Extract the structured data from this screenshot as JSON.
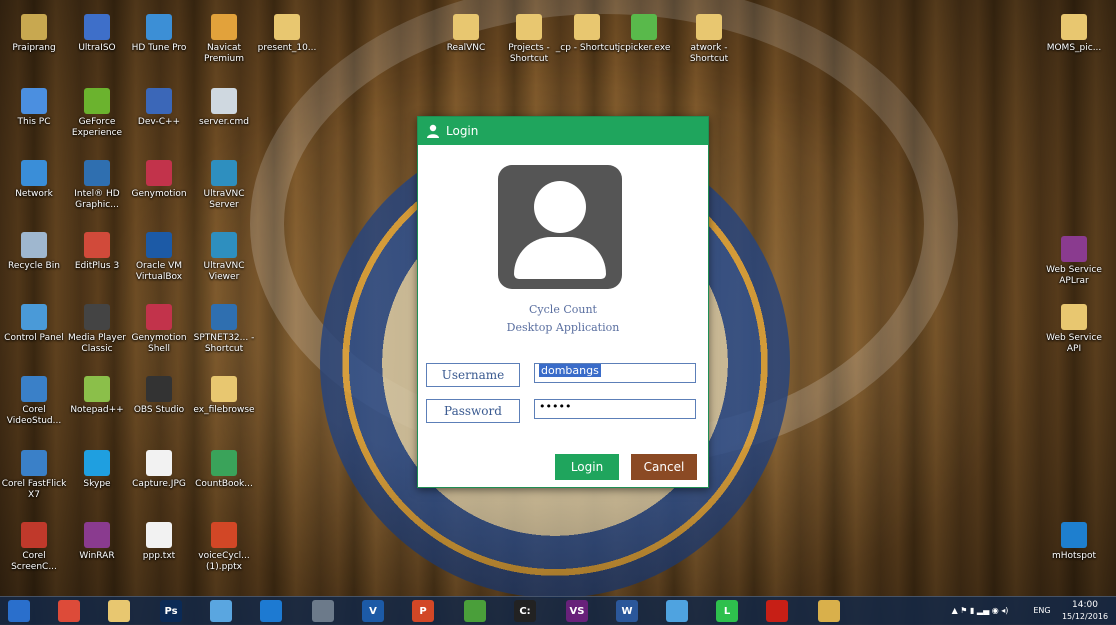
{
  "desktop": {
    "icons": [
      {
        "label": "Praiprang",
        "color": "#c8a850"
      },
      {
        "label": "UltraISO",
        "color": "#3e6fc9"
      },
      {
        "label": "HD Tune Pro",
        "color": "#3c8fd6"
      },
      {
        "label": "Navicat Premium",
        "color": "#e2a23b"
      },
      {
        "label": "present_10...",
        "color": "#e8c770"
      },
      {
        "label": "This PC",
        "color": "#4b8fe0"
      },
      {
        "label": "GeForce Experience",
        "color": "#6bb32e"
      },
      {
        "label": "Dev-C++",
        "color": "#3b67b8"
      },
      {
        "label": "server.cmd",
        "color": "#cfd8e0"
      },
      {
        "label": "Network",
        "color": "#3a8ed8"
      },
      {
        "label": "Intel® HD Graphic...",
        "color": "#2f6fb0"
      },
      {
        "label": "Genymotion",
        "color": "#c2334b"
      },
      {
        "label": "UltraVNC Server",
        "color": "#2e8fbf"
      },
      {
        "label": "Recycle Bin",
        "color": "#9fb7cf"
      },
      {
        "label": "EditPlus 3",
        "color": "#d14a3a"
      },
      {
        "label": "Oracle VM VirtualBox",
        "color": "#1c5aa6"
      },
      {
        "label": "UltraVNC Viewer",
        "color": "#2e8fbf"
      },
      {
        "label": "Control Panel",
        "color": "#4a9ad8"
      },
      {
        "label": "Media Player Classic",
        "color": "#444444"
      },
      {
        "label": "Genymotion Shell",
        "color": "#c2334b"
      },
      {
        "label": "SPTNET32... - Shortcut",
        "color": "#2f6fb0"
      },
      {
        "label": "Corel VideoStud...",
        "color": "#3a80c8"
      },
      {
        "label": "Notepad++",
        "color": "#8bbf4a"
      },
      {
        "label": "OBS Studio",
        "color": "#333333"
      },
      {
        "label": "ex_filebrowse",
        "color": "#e8c770"
      },
      {
        "label": "Corel FastFlick X7",
        "color": "#3a80c8"
      },
      {
        "label": "Skype",
        "color": "#1f9fe0"
      },
      {
        "label": "Capture.JPG",
        "color": "#f2f2f2"
      },
      {
        "label": "CountBook...",
        "color": "#3aa35a"
      },
      {
        "label": "Corel ScreenC...",
        "color": "#c0392b"
      },
      {
        "label": "WinRAR",
        "color": "#8a3b8f"
      },
      {
        "label": "ppp.txt",
        "color": "#f2f2f2"
      },
      {
        "label": "voiceCycl... (1).pptx",
        "color": "#d24726"
      },
      {
        "label": "RealVNC",
        "color": "#e8c770"
      },
      {
        "label": "Projects - Shortcut",
        "color": "#e8c770"
      },
      {
        "label": "_cp - Shortcut",
        "color": "#e8c770"
      },
      {
        "label": "jcpicker.exe",
        "color": "#59b94b"
      },
      {
        "label": "atwork - Shortcut",
        "color": "#e8c770"
      },
      {
        "label": "MOMS_pic...",
        "color": "#e8c770"
      },
      {
        "label": "Web Service APLrar",
        "color": "#8a3b8f"
      },
      {
        "label": "Web Service API",
        "color": "#e8c770"
      },
      {
        "label": "mHotspot",
        "color": "#1e7fcf"
      }
    ]
  },
  "login_window": {
    "title": "Login",
    "app_name_line1": "Cycle Count",
    "app_name_line2": "Desktop Application",
    "username_label": "Username",
    "username_value": "dombangs",
    "password_label": "Password",
    "password_value": "•••••",
    "login_button": "Login",
    "cancel_button": "Cancel",
    "colors": {
      "title_bar": "#1fa55d",
      "login_button": "#1fa55d",
      "cancel_button": "#8b4a24"
    }
  },
  "taskbar": {
    "items": [
      {
        "name": "start",
        "color": "#2a6fcc",
        "text": ""
      },
      {
        "name": "chrome",
        "color": "#dd4b39",
        "text": ""
      },
      {
        "name": "file-explorer",
        "color": "#e8c770",
        "text": ""
      },
      {
        "name": "photoshop",
        "color": "#0b2a56",
        "text": "Ps"
      },
      {
        "name": "app-4",
        "color": "#5aa6e0",
        "text": ""
      },
      {
        "name": "app-5",
        "color": "#1d7ad2",
        "text": ""
      },
      {
        "name": "app-6",
        "color": "#6c7a8a",
        "text": ""
      },
      {
        "name": "virtualbox",
        "color": "#1c5aa6",
        "text": "V"
      },
      {
        "name": "powerpoint",
        "color": "#d24726",
        "text": "P"
      },
      {
        "name": "app-9",
        "color": "#4a9f3a",
        "text": ""
      },
      {
        "name": "cmd",
        "color": "#222222",
        "text": "C:"
      },
      {
        "name": "visual-studio",
        "color": "#68217a",
        "text": "VS"
      },
      {
        "name": "word",
        "color": "#2b579a",
        "text": "W"
      },
      {
        "name": "paint",
        "color": "#4fa3e0",
        "text": ""
      },
      {
        "name": "line",
        "color": "#2ec04d",
        "text": "L"
      },
      {
        "name": "acrobat",
        "color": "#c71f16",
        "text": ""
      },
      {
        "name": "app-16",
        "color": "#d9b04b",
        "text": ""
      }
    ],
    "language": "ENG",
    "time": "14:00",
    "date": "15/12/2016"
  }
}
